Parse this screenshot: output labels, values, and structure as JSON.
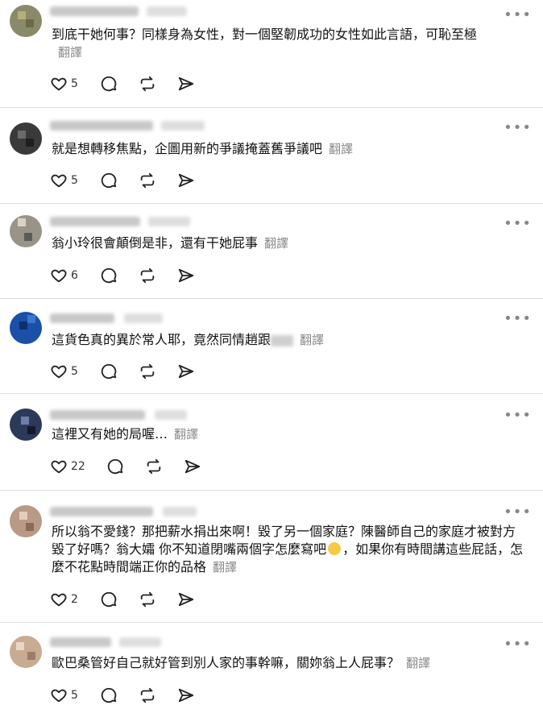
{
  "ui": {
    "translate_label": "翻譯"
  },
  "posts": [
    {
      "text": "到底干她何事？同樣身為女性，對一個堅韌成功的女性如此言語，可恥至極",
      "likes": "5"
    },
    {
      "text": "就是想轉移焦點，企圖用新的爭議掩蓋舊爭議吧",
      "likes": "5"
    },
    {
      "text": "翁小玲很會顛倒是非，還有干她屁事",
      "likes": "6"
    },
    {
      "text_before": "這貨色真的異於常人耶，竟然同情趙跟",
      "likes": "5"
    },
    {
      "text": "這裡又有她的局喔…",
      "likes": "22"
    },
    {
      "text_before": "所以翁不愛錢？那把薪水捐出來啊！毀了另一個家庭？陳醫師自己的家庭才被對方毀了好嗎？翁大孀 你不知道閉嘴兩個字怎麼寫吧",
      "text_after": "，如果你有時間講這些屁話，怎麼不花點時間端正你的品格",
      "likes": "2"
    },
    {
      "text": "歐巴桑管好自己就好管到別人家的事幹嘛，關妳翁上人屁事？",
      "likes": "5"
    }
  ],
  "icons": {
    "like": "heart-icon",
    "comment": "comment-icon",
    "repost": "repost-icon",
    "share": "share-icon",
    "more": "more-icon"
  }
}
